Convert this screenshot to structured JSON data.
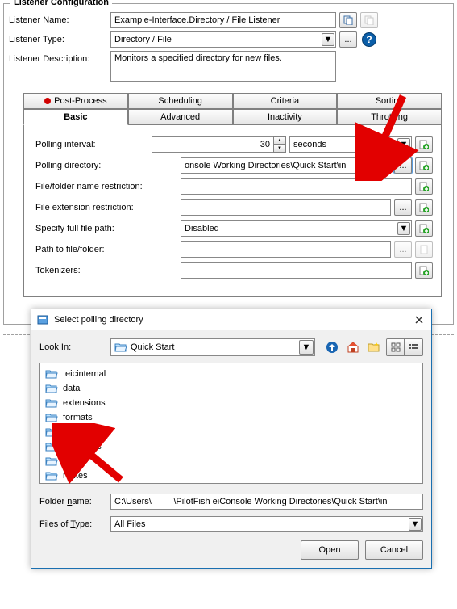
{
  "fieldset": {
    "legend": "Listener Configuration"
  },
  "form": {
    "name_label": "Listener Name:",
    "name_value": "Example-Interface.Directory / File Listener",
    "type_label": "Listener Type:",
    "type_value": "Directory / File",
    "desc_label": "Listener Description:",
    "desc_value": "Monitors a specified directory for new files."
  },
  "tabs_top": [
    "Post-Process",
    "Scheduling",
    "Criteria",
    "Sorting"
  ],
  "tabs_bottom": [
    "Basic",
    "Advanced",
    "Inactivity",
    "Throttling"
  ],
  "panel": {
    "polling_interval_label": "Polling interval:",
    "polling_interval_value": "30",
    "polling_interval_unit": "seconds",
    "polling_dir_label": "Polling directory:",
    "polling_dir_value": "onsole Working Directories\\Quick Start\\in",
    "file_restrict_label": "File/folder name restriction:",
    "file_restrict_value": "",
    "ext_restrict_label": "File extension restriction:",
    "ext_restrict_value": "",
    "fullpath_label": "Specify full file path:",
    "fullpath_value": "Disabled",
    "path_label": "Path to file/folder:",
    "path_value": "",
    "tokenizers_label": "Tokenizers:",
    "tokenizers_value": ""
  },
  "dialog": {
    "title": "Select polling directory",
    "lookin_label": "Look In:",
    "lookin_value": "Quick Start",
    "entries": [
      {
        "name": ".eicinternal"
      },
      {
        "name": "data"
      },
      {
        "name": "extensions"
      },
      {
        "name": "formats"
      },
      {
        "name": "in",
        "selected": true
      },
      {
        "name": "interfaces"
      },
      {
        "name": "lib"
      },
      {
        "name": "routes"
      }
    ],
    "foldername_label": "Folder name:",
    "foldername_value": "C:\\Users\\         \\PilotFish eiConsole Working Directories\\Quick Start\\in",
    "type_label": "Files of Type:",
    "type_value": "All Files",
    "open": "Open",
    "cancel": "Cancel"
  }
}
